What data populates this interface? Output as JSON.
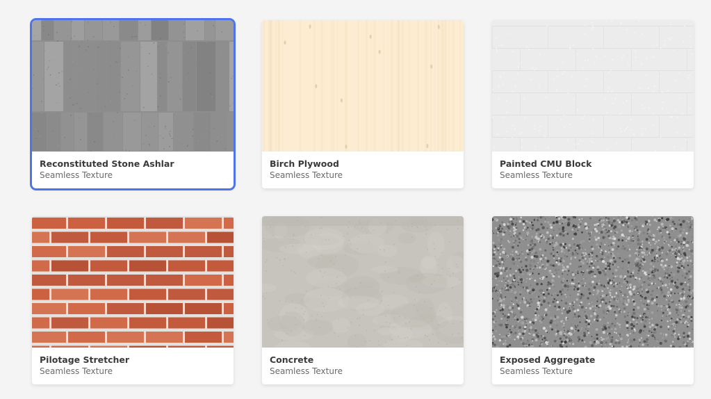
{
  "colors": {
    "background": "#f4f4f4",
    "selection": "#4f73ea",
    "card": "#ffffff"
  },
  "cards": [
    {
      "title": "Reconstituted Stone Ashlar",
      "subtitle": "Seamless Texture",
      "texture": "stone-ashlar",
      "selected": true
    },
    {
      "title": "Birch Plywood",
      "subtitle": "Seamless Texture",
      "texture": "birch-plywood",
      "selected": false
    },
    {
      "title": "Painted CMU Block",
      "subtitle": "Seamless Texture",
      "texture": "painted-cmu",
      "selected": false
    },
    {
      "title": "Pilotage Stretcher",
      "subtitle": "Seamless Texture",
      "texture": "brick",
      "selected": false
    },
    {
      "title": "Concrete",
      "subtitle": "Seamless Texture",
      "texture": "concrete",
      "selected": false
    },
    {
      "title": "Exposed Aggregate",
      "subtitle": "Seamless Texture",
      "texture": "aggregate",
      "selected": false
    }
  ]
}
